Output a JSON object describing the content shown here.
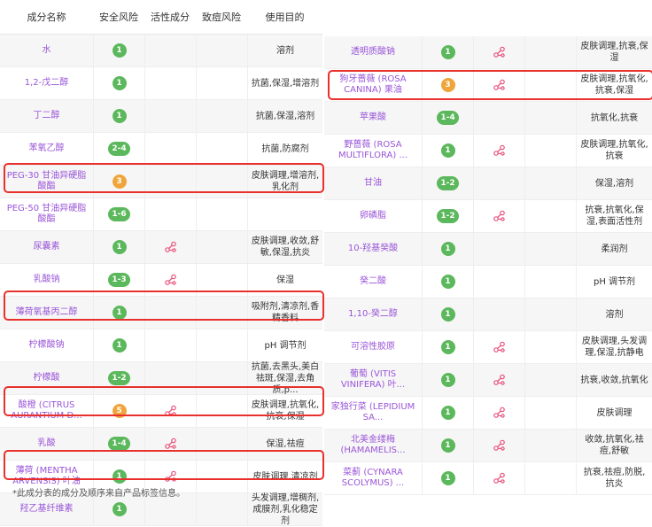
{
  "headers": {
    "name": "成分名称",
    "safety": "安全风险",
    "active": "活性成分",
    "acne": "致痘风险",
    "purpose": "使用目的"
  },
  "icons": {
    "active_icon": "molecule-icon",
    "safety_color_green": "#5cb85c",
    "safety_color_orange": "#f0a53c",
    "name_color": "#9a55d8",
    "highlight_color": "#e8302c"
  },
  "left_rows": [
    {
      "name": "水",
      "safety": "1",
      "level": "g",
      "active": false,
      "purpose": "溶剂",
      "highlight": false
    },
    {
      "name": "1,2-戊二醇",
      "safety": "1",
      "level": "g",
      "active": false,
      "purpose": "抗菌,保湿,增溶剂",
      "highlight": false
    },
    {
      "name": "丁二醇",
      "safety": "1",
      "level": "g",
      "active": false,
      "purpose": "抗菌,保湿,溶剂",
      "highlight": false
    },
    {
      "name": "苯氧乙醇",
      "safety": "2-4",
      "level": "g",
      "active": false,
      "purpose": "抗菌,防腐剂",
      "highlight": false
    },
    {
      "name": "PEG-30 甘油异硬脂酸酯",
      "safety": "3",
      "level": "o",
      "active": false,
      "purpose": "皮肤调理,增溶剂,乳化剂",
      "highlight": true
    },
    {
      "name": "PEG-50 甘油异硬脂酸酯",
      "safety": "1-6",
      "level": "g",
      "active": false,
      "purpose": "",
      "highlight": false
    },
    {
      "name": "尿囊素",
      "safety": "1",
      "level": "g",
      "active": true,
      "purpose": "皮肤调理,收敛,舒敏,保湿,抗炎",
      "highlight": false
    },
    {
      "name": "乳酸钠",
      "safety": "1-3",
      "level": "g",
      "active": true,
      "purpose": "保湿",
      "highlight": false
    },
    {
      "name": "薄荷氧基丙二醇",
      "safety": "1",
      "level": "g",
      "active": false,
      "purpose": "吸附剂,清凉剂,香精香料",
      "highlight": true
    },
    {
      "name": "柠檬酸钠",
      "safety": "1",
      "level": "g",
      "active": false,
      "purpose": "pH 调节剂",
      "highlight": false
    },
    {
      "name": "柠檬酸",
      "safety": "1-2",
      "level": "g",
      "active": false,
      "purpose": "抗菌,去黑头,美白祛斑,保湿,去角质,p...",
      "highlight": false
    },
    {
      "name": "酸橙 (CITRUS AURANTIUM D...",
      "safety": "5",
      "level": "o",
      "active": true,
      "purpose": "皮肤调理,抗氧化,抗衰,保湿",
      "highlight": true
    },
    {
      "name": "乳酸",
      "safety": "1-4",
      "level": "g",
      "active": true,
      "purpose": "保湿,祛痘",
      "highlight": false
    },
    {
      "name": "薄荷 (MENTHA ARVENSIS) 叶油",
      "safety": "1",
      "level": "g",
      "active": true,
      "purpose": "皮肤调理,清凉剂",
      "highlight": true
    },
    {
      "name": "羟乙基纤维素",
      "safety": "1",
      "level": "g",
      "active": false,
      "purpose": "头发调理,增稠剂,成膜剂,乳化稳定剂",
      "highlight": false
    }
  ],
  "right_rows": [
    {
      "name": "透明质酸钠",
      "safety": "1",
      "level": "g",
      "active": true,
      "purpose": "皮肤调理,抗衰,保湿",
      "highlight": false
    },
    {
      "name": "狗牙蔷薇 (ROSA CANINA) 果油",
      "safety": "3",
      "level": "o",
      "active": true,
      "purpose": "皮肤调理,抗氧化,抗衰,保湿",
      "highlight": true
    },
    {
      "name": "苹果酸",
      "safety": "1-4",
      "level": "g",
      "active": false,
      "purpose": "抗氧化,抗衰",
      "highlight": false
    },
    {
      "name": "野蔷薇 (ROSA MULTIFLORA) ...",
      "safety": "1",
      "level": "g",
      "active": true,
      "purpose": "皮肤调理,抗氧化,抗衰",
      "highlight": false
    },
    {
      "name": "甘油",
      "safety": "1-2",
      "level": "g",
      "active": false,
      "purpose": "保湿,溶剂",
      "highlight": false
    },
    {
      "name": "卵磷脂",
      "safety": "1-2",
      "level": "g",
      "active": true,
      "purpose": "抗衰,抗氧化,保湿,表面活性剂",
      "highlight": false
    },
    {
      "name": "10-羟基癸酸",
      "safety": "1",
      "level": "g",
      "active": false,
      "purpose": "柔润剂",
      "highlight": false
    },
    {
      "name": "癸二酸",
      "safety": "1",
      "level": "g",
      "active": false,
      "purpose": "pH 调节剂",
      "highlight": false
    },
    {
      "name": "1,10-癸二醇",
      "safety": "1",
      "level": "g",
      "active": false,
      "purpose": "溶剂",
      "highlight": false
    },
    {
      "name": "可溶性胶原",
      "safety": "1",
      "level": "g",
      "active": true,
      "purpose": "皮肤调理,头发调理,保湿,抗静电",
      "highlight": false
    },
    {
      "name": "葡萄 (VITIS VINIFERA) 叶...",
      "safety": "1",
      "level": "g",
      "active": true,
      "purpose": "抗衰,收敛,抗氧化",
      "highlight": false
    },
    {
      "name": "家独行菜 (LEPIDIUM SA...",
      "safety": "1",
      "level": "g",
      "active": true,
      "purpose": "皮肤调理",
      "highlight": false
    },
    {
      "name": "北美金缕梅 (HAMAMELIS...",
      "safety": "1",
      "level": "g",
      "active": true,
      "purpose": "收敛,抗氧化,祛痘,舒敏",
      "highlight": false
    },
    {
      "name": "菜蓟 (CYNARA SCOLYMUS) ...",
      "safety": "1",
      "level": "g",
      "active": true,
      "purpose": "抗衰,祛痘,防脱,抗炎",
      "highlight": false
    }
  ],
  "footnote": "*此成分表的成分及顺序来自产品标签信息。"
}
